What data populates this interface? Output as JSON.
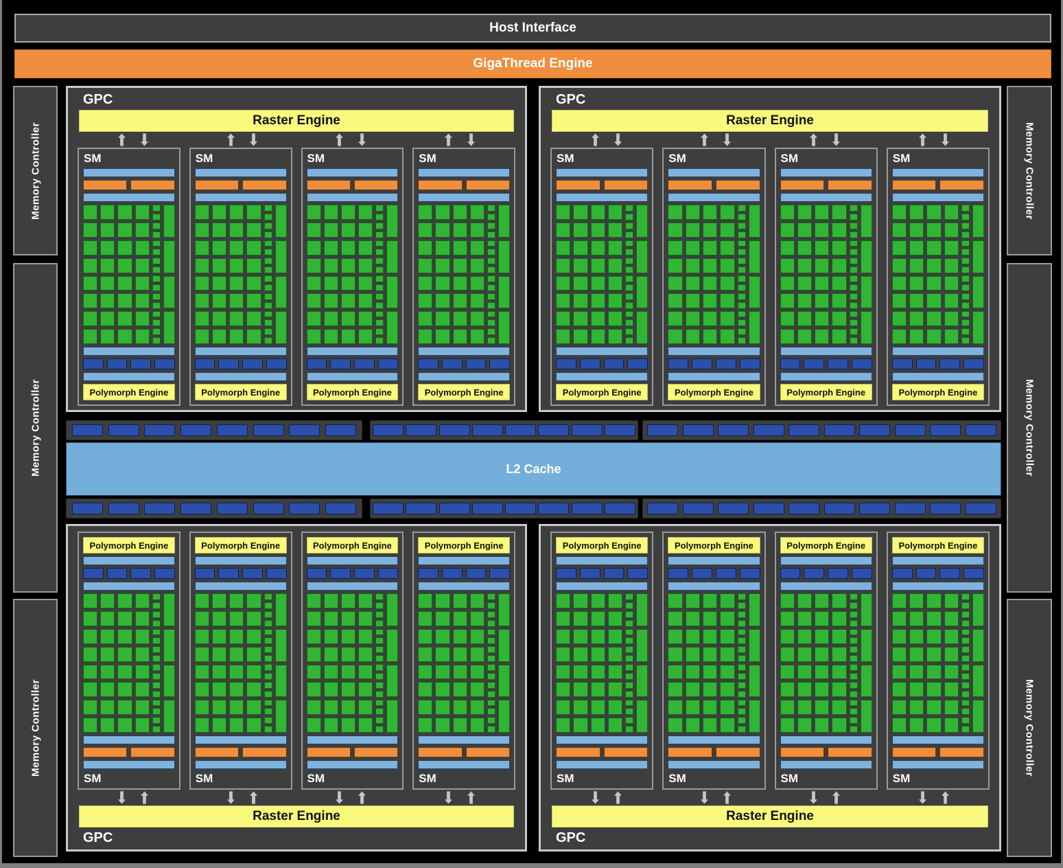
{
  "page": {
    "host_interface_label": "Host Interface",
    "gigathread_label": "GigaThread Engine"
  },
  "memory_controller": {
    "label": "Memory Controller",
    "left_blocks": 3,
    "right_blocks": 3
  },
  "gpc": {
    "label": "GPC",
    "count": 4,
    "raster_engine_label": "Raster Engine",
    "sms_per_gpc": 4
  },
  "sm": {
    "label": "SM",
    "polymorph_engine_label": "Polymorph Engine",
    "core_columns": 4,
    "core_rows": 8,
    "mini_blocks": 16,
    "tall_blocks": 4,
    "tex_blocks": 4,
    "scheduler_bars": 2
  },
  "l2": {
    "label": "L2 Cache",
    "strip_rows": 2,
    "strip_segment_block_counts": [
      8,
      8,
      10
    ]
  },
  "colors": {
    "background": "#000000",
    "panel": "#3e3e3e",
    "orange": "#ee8e3e",
    "light_blue": "#7fb2dc",
    "dark_blue": "#2b50ab",
    "core_green": "#31b535",
    "engine_yellow": "#f8f97d",
    "l2_blue": "#74aeda",
    "arrow_gray": "#c6c6c6"
  }
}
